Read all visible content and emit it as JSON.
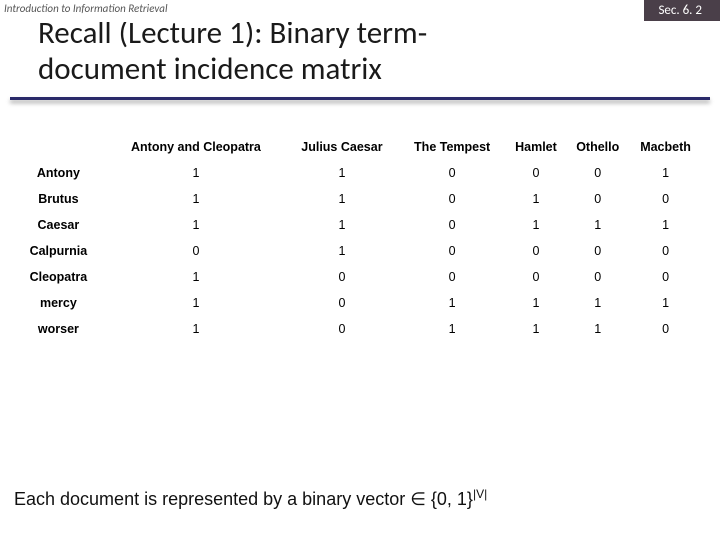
{
  "header": {
    "course": "Introduction to Information Retrieval",
    "section": "Sec. 6. 2",
    "title_line1": "Recall (Lecture 1): Binary term-",
    "title_line2": "document incidence matrix"
  },
  "chart_data": {
    "type": "table",
    "title": "Binary term-document incidence matrix",
    "columns": [
      "Antony and Cleopatra",
      "Julius Caesar",
      "The Tempest",
      "Hamlet",
      "Othello",
      "Macbeth"
    ],
    "rows": [
      "Antony",
      "Brutus",
      "Caesar",
      "Calpurnia",
      "Cleopatra",
      "mercy",
      "worser"
    ],
    "values": [
      [
        1,
        1,
        0,
        0,
        0,
        1
      ],
      [
        1,
        1,
        0,
        1,
        0,
        0
      ],
      [
        1,
        1,
        0,
        1,
        1,
        1
      ],
      [
        0,
        1,
        0,
        0,
        0,
        0
      ],
      [
        1,
        0,
        0,
        0,
        0,
        0
      ],
      [
        1,
        0,
        1,
        1,
        1,
        1
      ],
      [
        1,
        0,
        1,
        1,
        1,
        0
      ]
    ]
  },
  "summary": {
    "prefix": "Each document is represented by a binary vector ∈ {0, 1}",
    "sup": "|V|"
  }
}
